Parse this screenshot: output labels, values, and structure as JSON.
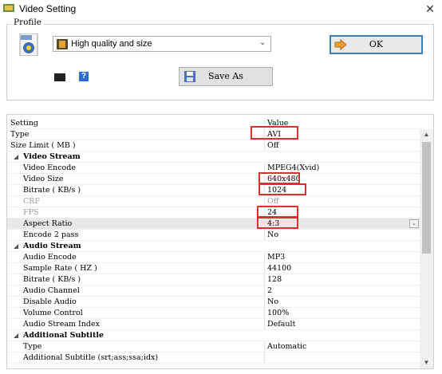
{
  "window": {
    "title": "Video Setting",
    "close_glyph": "✕"
  },
  "profile": {
    "legend": "Profile",
    "selected": "High quality and size",
    "ok_label": "OK",
    "save_as_label": "Save As",
    "help_glyph": "?"
  },
  "grid": {
    "header": {
      "name": "Setting",
      "value": "Value"
    },
    "rows": [
      {
        "name": "Type",
        "value": "AVI"
      },
      {
        "name": "Size Limit ( MB )",
        "value": "Off"
      },
      {
        "name": "Video Stream",
        "value": ""
      },
      {
        "name": "Video Encode",
        "value": "MPEG4(Xvid)"
      },
      {
        "name": "Video Size",
        "value": "640x480"
      },
      {
        "name": "Bitrate ( KB/s )",
        "value": "1024"
      },
      {
        "name": "CRF",
        "value": "Off"
      },
      {
        "name": "FPS",
        "value": "24"
      },
      {
        "name": "Aspect Ratio",
        "value": "4:3"
      },
      {
        "name": "Encode 2 pass",
        "value": "No"
      },
      {
        "name": "Audio Stream",
        "value": ""
      },
      {
        "name": "Audio Encode",
        "value": "MP3"
      },
      {
        "name": "Sample Rate ( HZ )",
        "value": "44100"
      },
      {
        "name": "Bitrate ( KB/s )",
        "value": "128"
      },
      {
        "name": "Audio Channel",
        "value": "2"
      },
      {
        "name": "Disable Audio",
        "value": "No"
      },
      {
        "name": "Volume Control",
        "value": "100%"
      },
      {
        "name": "Audio Stream Index",
        "value": "Default"
      },
      {
        "name": "Additional Subtitle",
        "value": ""
      },
      {
        "name": "Type",
        "value": "Automatic"
      },
      {
        "name": "Additional Subtitle (srt;ass;ssa;idx)",
        "value": ""
      }
    ]
  },
  "icons": {
    "chevron": "⌄",
    "expand_triangle": "◢",
    "scroll_up": "▲",
    "scroll_down": "▼"
  },
  "colors": {
    "accent_border": "#3c7fb1",
    "highlight_red": "#d8322e",
    "selected_row": "#e8e8e8"
  }
}
